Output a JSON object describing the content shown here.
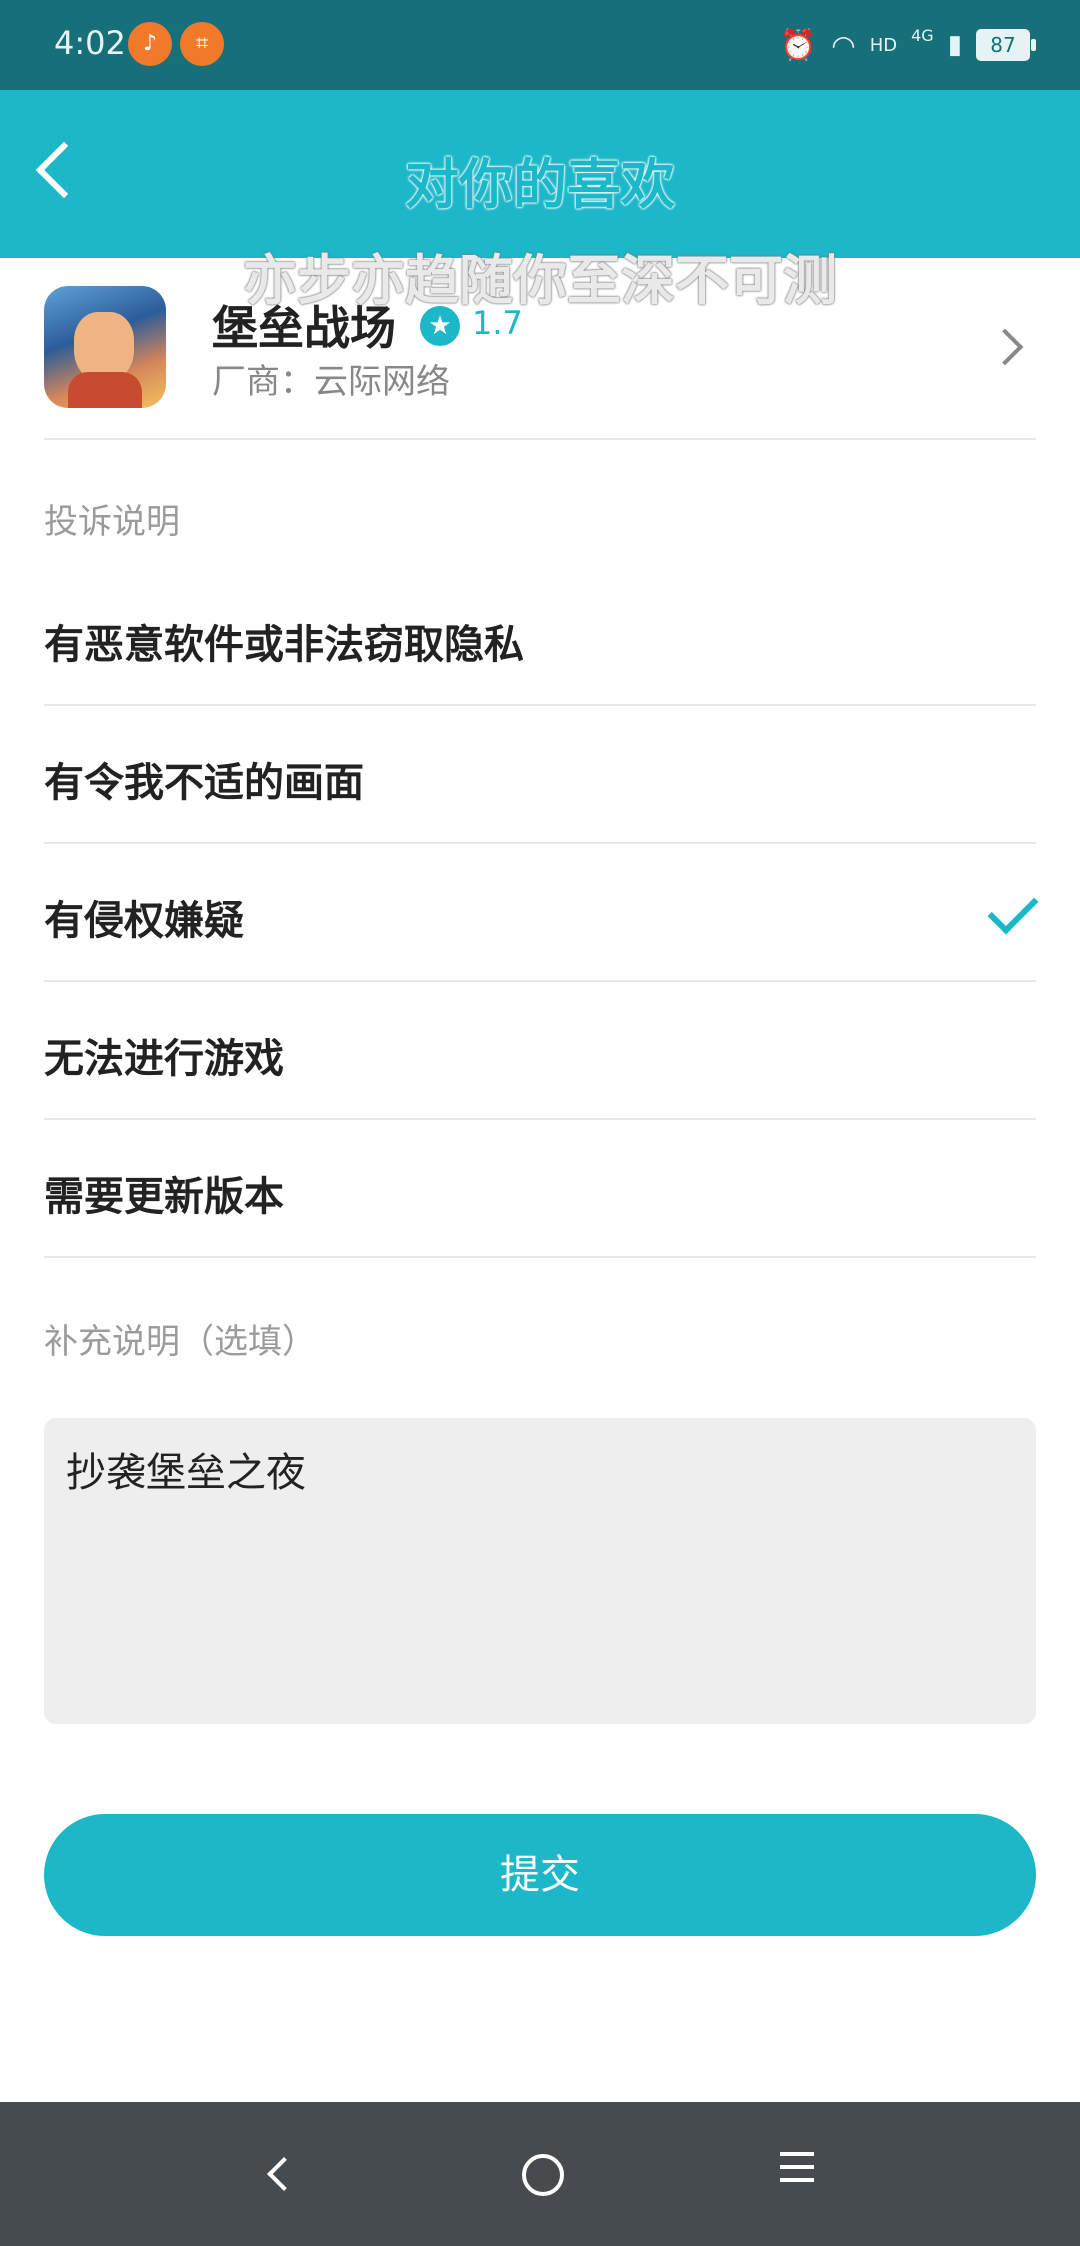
{
  "status_bar": {
    "time": "4:02",
    "network": "4G",
    "hd": "HD",
    "battery": "87"
  },
  "header": {
    "title": "对你的喜欢",
    "overlay_subtitle": "亦步亦趋随你至深不可测"
  },
  "game": {
    "name": "堡垒战场",
    "rating": "1.7",
    "vendor": "厂商：云际网络"
  },
  "complaint_section_label": "投诉说明",
  "options": [
    {
      "label": "有恶意软件或非法窃取隐私",
      "selected": false
    },
    {
      "label": "有令我不适的画面",
      "selected": false
    },
    {
      "label": "有侵权嫌疑",
      "selected": true
    },
    {
      "label": "无法进行游戏",
      "selected": false
    },
    {
      "label": "需要更新版本",
      "selected": false
    }
  ],
  "supplement_label": "补充说明（选填）",
  "supplement_value": "抄袭堡垒之夜",
  "submit_label": "提交",
  "colors": {
    "accent": "#1cb7c8",
    "status_bar": "#176f79",
    "nav_bar": "#464b50"
  },
  "icons": [
    "back-arrow-icon",
    "star-icon",
    "chevron-right-icon",
    "check-icon",
    "nav-back-icon",
    "nav-home-icon",
    "nav-menu-icon"
  ]
}
